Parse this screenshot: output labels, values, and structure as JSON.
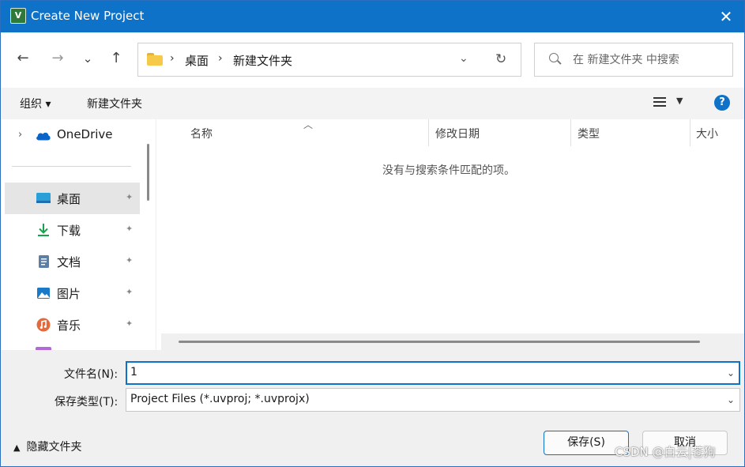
{
  "window": {
    "app_icon_text": "V",
    "title": "Create New Project",
    "close_icon": "✕"
  },
  "navigation": {
    "back_icon": "←",
    "forward_icon": "→",
    "recent_icon": "⌄",
    "up_icon": "↑"
  },
  "address": {
    "crumbs": [
      "桌面",
      "新建文件夹"
    ],
    "separator": "›",
    "dropdown_icon": "⌄",
    "refresh_icon": "↻"
  },
  "search": {
    "placeholder": "在 新建文件夹 中搜索"
  },
  "toolbar": {
    "organize_label": "组织 ▾",
    "new_folder_label": "新建文件夹",
    "view_dropdown": "▼",
    "help_icon": "?"
  },
  "sidebar": {
    "onedrive_label": "OneDrive",
    "items": [
      {
        "label": "桌面",
        "icon": "desktop-icon",
        "pinned": true,
        "selected": true
      },
      {
        "label": "下载",
        "icon": "download-icon",
        "pinned": true
      },
      {
        "label": "文档",
        "icon": "document-icon",
        "pinned": true
      },
      {
        "label": "图片",
        "icon": "pictures-icon",
        "pinned": true
      },
      {
        "label": "音乐",
        "icon": "music-icon",
        "pinned": true
      }
    ],
    "pin_icon": "📌"
  },
  "file_list": {
    "columns": [
      "名称",
      "修改日期",
      "类型",
      "大小"
    ],
    "empty_message": "没有与搜索条件匹配的项。"
  },
  "form": {
    "filename_label": "文件名(N):",
    "filename_value": "1",
    "filetype_label": "保存类型(T):",
    "filetype_value": "Project Files (*.uvproj; *.uvprojx)"
  },
  "footer": {
    "hide_folders_label": "隐藏文件夹",
    "save_label": "保存(S)",
    "cancel_label": "取消"
  },
  "watermark": "CSDN @白云|苍狗",
  "colors": {
    "titlebar": "#0f72c9",
    "accent": "#0f72c9"
  }
}
